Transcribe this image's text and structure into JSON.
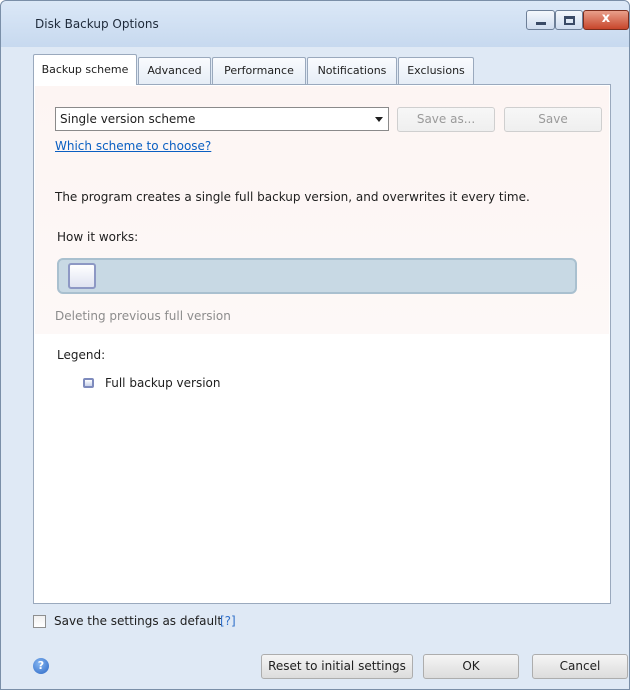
{
  "window": {
    "title": "Disk Backup Options",
    "controls": {
      "minimize": "minimize",
      "maximize": "maximize",
      "close": "x"
    }
  },
  "tabs": [
    {
      "label": "Backup scheme",
      "active": true
    },
    {
      "label": "Advanced"
    },
    {
      "label": "Performance"
    },
    {
      "label": "Notifications"
    },
    {
      "label": "Exclusions"
    }
  ],
  "scheme": {
    "selected": "Single version scheme",
    "save_as_label": "Save as...",
    "save_label": "Save",
    "help_link": "Which scheme to choose?",
    "description": "The program creates a single full backup version, and overwrites it every time.",
    "how_it_works": "How it works:",
    "status_text": "Deleting previous full version"
  },
  "legend": {
    "title": "Legend:",
    "items": [
      {
        "label": "Full backup version"
      }
    ]
  },
  "defaults": {
    "label": "Save the settings as default",
    "help": "[?]"
  },
  "footer": {
    "reset_label": "Reset to initial settings",
    "ok_label": "OK",
    "cancel_label": "Cancel"
  },
  "icons": {
    "dropdown": "chevron-down-icon",
    "help": "help-icon",
    "backup_block": "backup-version-icon"
  },
  "colors": {
    "link": "#0a5fc2",
    "disabled_text": "#9a9a9a",
    "window_chrome": "#dfe9f5",
    "track": "#c8d9e4"
  }
}
